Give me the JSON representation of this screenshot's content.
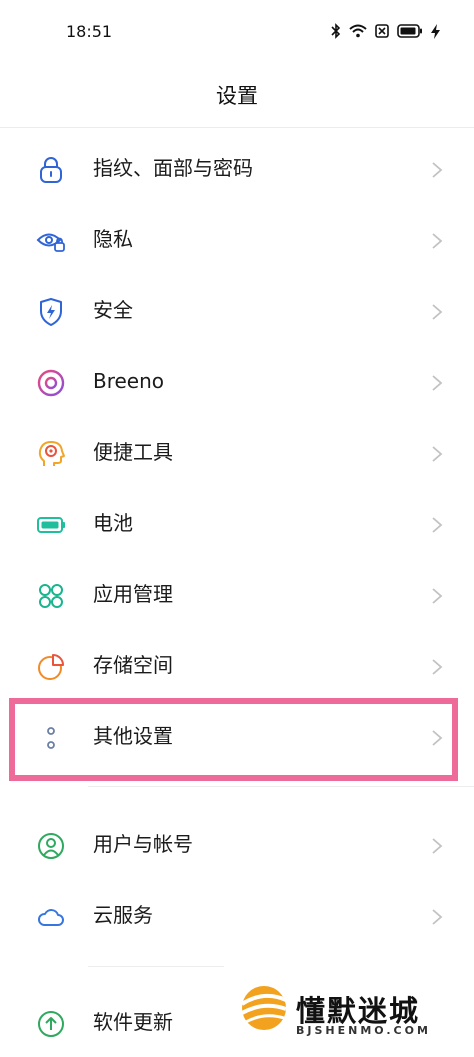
{
  "status_bar": {
    "time": "18:51",
    "icons": [
      "bluetooth-icon",
      "wifi-icon",
      "sim-off-icon",
      "battery-icon",
      "charging-icon"
    ]
  },
  "header": {
    "title": "设置"
  },
  "items": [
    {
      "label": "指纹、面部与密码",
      "icon": "lock-icon",
      "color": "#2f65d6"
    },
    {
      "label": "隐私",
      "icon": "privacy-eye-icon",
      "color": "#2f65d6"
    },
    {
      "label": "安全",
      "icon": "shield-icon",
      "color": "#2f65d6"
    },
    {
      "label": "Breeno",
      "icon": "breeno-icon",
      "color": "#c74ad6"
    },
    {
      "label": "便捷工具",
      "icon": "tools-head-icon",
      "color": "#f1a52b"
    },
    {
      "label": "电池",
      "icon": "battery-icon",
      "color": "#1fbf9d"
    },
    {
      "label": "应用管理",
      "icon": "apps-icon",
      "color": "#18b58e"
    },
    {
      "label": "存储空间",
      "icon": "storage-pie-icon",
      "color": "#f28a26"
    },
    {
      "label": "其他设置",
      "icon": "more-dots-icon",
      "color": "#6b7fa6"
    },
    {
      "label": "用户与帐号",
      "icon": "user-icon",
      "color": "#2fa860"
    },
    {
      "label": "云服务",
      "icon": "cloud-icon",
      "color": "#3576e0"
    },
    {
      "label": "软件更新",
      "icon": "update-icon",
      "color": "#2fa860"
    }
  ],
  "highlight_color": "#ee6a98",
  "watermark": {
    "text": "懂默迷城",
    "sub": "BJSHENMO.COM"
  }
}
